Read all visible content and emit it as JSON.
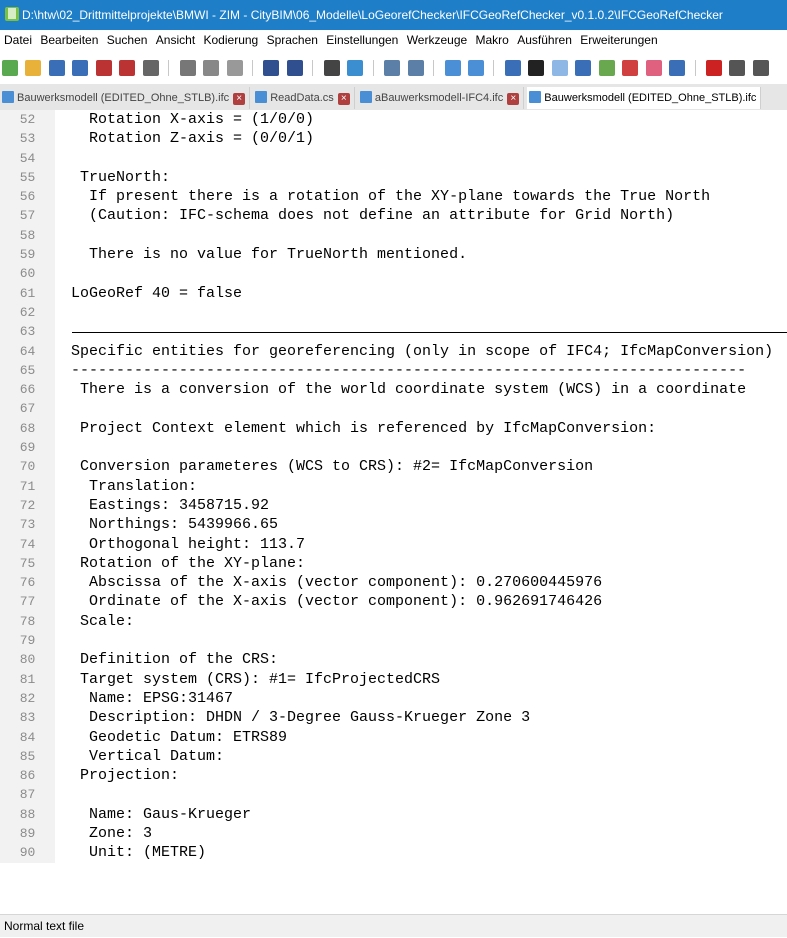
{
  "title": "D:\\htw\\02_Drittmittelprojekte\\BMWI - ZIM - CityBIM\\06_Modelle\\LoGeorefChecker\\IFCGeoRefChecker_v0.1.0.2\\IFCGeoRefChecker",
  "menu": [
    "Datei",
    "Bearbeiten",
    "Suchen",
    "Ansicht",
    "Kodierung",
    "Sprachen",
    "Einstellungen",
    "Werkzeuge",
    "Makro",
    "Ausführen",
    "Erweiterungen"
  ],
  "tabs": [
    {
      "label": "Bauwerksmodell (EDITED_Ohne_STLB).ifc"
    },
    {
      "label": "ReadData.cs"
    },
    {
      "label": "aBauwerksmodell-IFC4.ifc"
    },
    {
      "label": "Bauwerksmodell (EDITED_Ohne_STLB).ifc"
    }
  ],
  "lines": [
    {
      "n": "52",
      "t": "   Rotation X-axis = (1/0/0)"
    },
    {
      "n": "53",
      "t": "   Rotation Z-axis = (0/0/1)"
    },
    {
      "n": "54",
      "t": ""
    },
    {
      "n": "55",
      "t": "  TrueNorth:"
    },
    {
      "n": "56",
      "t": "   If present there is a rotation of the XY-plane towards the True North"
    },
    {
      "n": "57",
      "t": "   (Caution: IFC-schema does not define an attribute for Grid North)"
    },
    {
      "n": "58",
      "t": ""
    },
    {
      "n": "59",
      "t": "   There is no value for TrueNorth mentioned."
    },
    {
      "n": "60",
      "t": ""
    },
    {
      "n": "61",
      "t": " LoGeoRef 40 = false"
    },
    {
      "n": "62",
      "t": ""
    },
    {
      "n": "63",
      "t": "",
      "rule": true
    },
    {
      "n": "64",
      "t": " Specific entities for georeferencing (only in scope of IFC4; IfcMapConversion)"
    },
    {
      "n": "65",
      "t": " ---------------------------------------------------------------------------"
    },
    {
      "n": "66",
      "t": "  There is a conversion of the world coordinate system (WCS) in a coordinate"
    },
    {
      "n": "67",
      "t": ""
    },
    {
      "n": "68",
      "t": "  Project Context element which is referenced by IfcMapConversion:"
    },
    {
      "n": "69",
      "t": ""
    },
    {
      "n": "70",
      "t": "  Conversion parameteres (WCS to CRS): #2= IfcMapConversion"
    },
    {
      "n": "71",
      "t": "   Translation:"
    },
    {
      "n": "72",
      "t": "   Eastings: 3458715.92"
    },
    {
      "n": "73",
      "t": "   Northings: 5439966.65"
    },
    {
      "n": "74",
      "t": "   Orthogonal height: 113.7"
    },
    {
      "n": "75",
      "t": "  Rotation of the XY-plane:"
    },
    {
      "n": "76",
      "t": "   Abscissa of the X-axis (vector component): 0.270600445976"
    },
    {
      "n": "77",
      "t": "   Ordinate of the X-axis (vector component): 0.962691746426"
    },
    {
      "n": "78",
      "t": "  Scale:"
    },
    {
      "n": "79",
      "t": ""
    },
    {
      "n": "80",
      "t": "  Definition of the CRS:"
    },
    {
      "n": "81",
      "t": "  Target system (CRS): #1= IfcProjectedCRS"
    },
    {
      "n": "82",
      "t": "   Name: EPSG:31467"
    },
    {
      "n": "83",
      "t": "   Description: DHDN / 3-Degree Gauss-Krueger Zone 3"
    },
    {
      "n": "84",
      "t": "   Geodetic Datum: ETRS89"
    },
    {
      "n": "85",
      "t": "   Vertical Datum:"
    },
    {
      "n": "86",
      "t": "  Projection:"
    },
    {
      "n": "87",
      "t": ""
    },
    {
      "n": "88",
      "t": "   Name: Gaus-Krueger"
    },
    {
      "n": "89",
      "t": "   Zone: 3"
    },
    {
      "n": "90",
      "t": "   Unit: (METRE)"
    }
  ],
  "status": "Normal text file"
}
